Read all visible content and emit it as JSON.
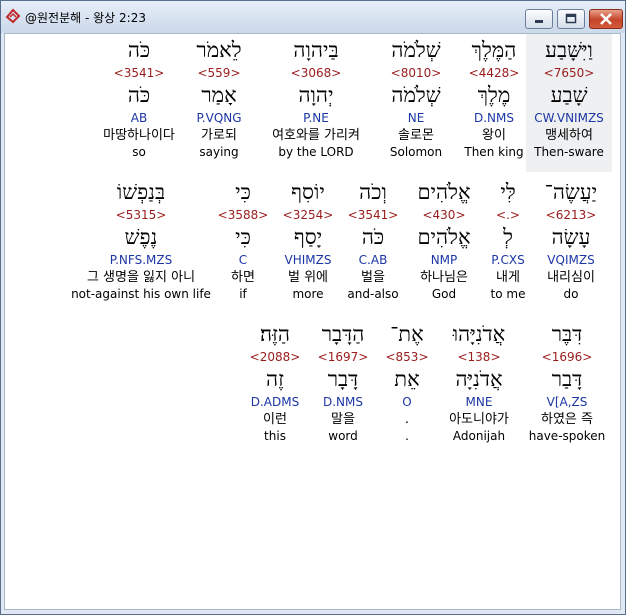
{
  "window": {
    "title": "@원전분해 - 왕상 2:23"
  },
  "rows": [
    {
      "words": [
        {
          "heb": "כֹּה",
          "strong": "<3541>",
          "lemma": "כֹּה",
          "morph": "AB",
          "kor": "마땅하나이다",
          "eng": "so"
        },
        {
          "heb": "לֵאמֹר",
          "strong": "<559>",
          "lemma": "אָמַר",
          "morph": "P.VQNG",
          "kor": "가로되",
          "eng": "saying"
        },
        {
          "heb": "בַּיהוָה",
          "strong": "<3068>",
          "lemma": "יְהוָה",
          "morph": "P.NE",
          "kor": "여호와를 가리켜",
          "eng": "by the LORD"
        },
        {
          "heb": "שְׁלֹמֹה",
          "strong": "<8010>",
          "lemma": "שְׁלֹמֹה",
          "morph": "NE",
          "kor": "솔로몬",
          "eng": "Solomon"
        },
        {
          "heb": "הַמֶּלֶךְ",
          "strong": "<4428>",
          "lemma": "מֶלֶךְ",
          "morph": "D.NMS",
          "kor": "왕이",
          "eng": "Then king"
        },
        {
          "heb": "וַיִּשָּׁבַע",
          "strong": "<7650>",
          "lemma": "שָׁבַע",
          "morph": "CW.VNIMZS",
          "kor": "맹세하여",
          "eng": "Then-sware"
        }
      ]
    },
    {
      "words": [
        {
          "heb": "בְּנַפְשׁוֹ",
          "strong": "<5315>",
          "lemma": "נֶפֶשׁ",
          "morph": "P.NFS.MZS",
          "kor": "그 생명을 잃지 아니",
          "eng": "not-against his own life"
        },
        {
          "heb": "כִּי",
          "strong": "<3588>",
          "lemma": "כִּי",
          "morph": "C",
          "kor": "하면",
          "eng": "if"
        },
        {
          "heb": "יוֹסִף",
          "strong": "<3254>",
          "lemma": "יָסַף",
          "morph": "VHIMZS",
          "kor": "벌 위에",
          "eng": "more"
        },
        {
          "heb": "וְכֹה",
          "strong": "<3541>",
          "lemma": "כֹּה",
          "morph": "C.AB",
          "kor": "벌을",
          "eng": "and-also"
        },
        {
          "heb": "אֱלֹהִים",
          "strong": "<430>",
          "lemma": "אֱלֹהִים",
          "morph": "NMP",
          "kor": "하나님은",
          "eng": "God"
        },
        {
          "heb": "לִּי",
          "strong": "<.>",
          "lemma": "לְ",
          "morph": "P.CXS",
          "kor": "내게",
          "eng": "to me"
        },
        {
          "heb": "יַעֲשֶׂה־",
          "strong": "<6213>",
          "lemma": "עָשָׂה",
          "morph": "VQIMZS",
          "kor": "내리심이",
          "eng": "do"
        }
      ]
    },
    {
      "words": [
        {
          "heb": "הַזֶּה׃",
          "strong": "<2088>",
          "lemma": "זֶה",
          "morph": "D.ADMS",
          "kor": "이런",
          "eng": "this"
        },
        {
          "heb": "הַדָּבָר",
          "strong": "<1697>",
          "lemma": "דָּבָר",
          "morph": "D.NMS",
          "kor": "말을",
          "eng": "word"
        },
        {
          "heb": "אֶת־",
          "strong": "<853>",
          "lemma": "אֵת",
          "morph": "O",
          "kor": ".",
          "eng": "."
        },
        {
          "heb": "אֲדֹנִיָּהוּ",
          "strong": "<138>",
          "lemma": "אֲדֹנִיָּה",
          "morph": "MNE",
          "kor": "아도니야가",
          "eng": "Adonijah"
        },
        {
          "heb": "דִּבֶּר",
          "strong": "<1696>",
          "lemma": "דָּבַר",
          "morph": "V[A,ZS",
          "kor": "하였은 즉",
          "eng": "have-spoken"
        }
      ]
    }
  ],
  "colors": {
    "strong": "#9a1c1c",
    "morph": "#1c36a6",
    "highlight": "#eef0f2"
  },
  "icons": {
    "app": "bible-app-icon",
    "minimize": "minimize-icon",
    "maximize": "maximize-icon",
    "close": "close-icon"
  }
}
